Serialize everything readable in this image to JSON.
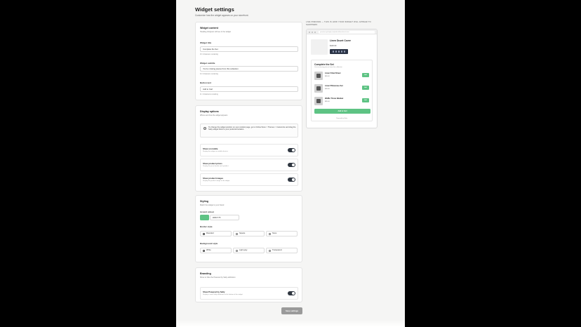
{
  "header": {
    "title": "Widget settings",
    "subtitle": "Customize how the widget appears on your storefront."
  },
  "content": {
    "title": "Widget content",
    "description": "Heading shoppers will see in the widget",
    "title_label": "Widget title",
    "title_value": "Complete the Set",
    "title_count": "16 / characters remaining",
    "subtitle_label": "Widget subtitle",
    "subtitle_value": "You're missing pieces from this collection",
    "subtitle_count": "44 / characters remaining",
    "button_label": "Button text",
    "button_value": "Add to Cart",
    "button_count": "11 / characters remaining"
  },
  "display": {
    "title": "Display options",
    "description": "Where and how the widget appears",
    "notice": "To change the widget position on your product page, go to Online Store > Themes > Customize and drag the Salty widget block to your preferred location.",
    "toggles": [
      {
        "title": "Show on mobile",
        "desc": "Display the widget on mobile devices"
      },
      {
        "title": "Show product prices",
        "desc": "Display the price beside each product"
      },
      {
        "title": "Show product images",
        "desc": "Display the product image in the widget"
      }
    ]
  },
  "styling": {
    "title": "Styling",
    "description": "Match the widget to your brand",
    "accent_label": "Accent colour",
    "accent_value": "#28C775",
    "accent_color": "#5ec384",
    "border_label": "Border style",
    "border_options": [
      "Rounded",
      "Square",
      "None"
    ],
    "background_label": "Background style",
    "background_options": [
      "White",
      "Light gray",
      "Transparent"
    ]
  },
  "branding": {
    "title": "Branding",
    "description": "Show or hide the Powered by Salty attribution",
    "toggle_title": "Show Powered by Salty",
    "toggle_desc": "Display a small Salty attribution at the bottom of the widget"
  },
  "save_label": "Save settings",
  "preview": {
    "label": "Live preview — this is how your widget will appear to shoppers",
    "url": "yourstore.myshopify.com/products/linen-duvet-cover",
    "product_name": "Linen Duvet Cover",
    "product_price": "$120.00",
    "widget_title": "Complete the Set",
    "widget_subtitle": "You're missing pieces from this collection",
    "items": [
      {
        "name": "Linen Fitted Sheet",
        "price": "$65.00",
        "add": "Add"
      },
      {
        "name": "Linen Pillowcase Set",
        "price": "$45.00",
        "add": "Add"
      },
      {
        "name": "Waffle Throw Blanket",
        "price": "$85.00",
        "add": "Add"
      }
    ],
    "cta": "Add to Cart",
    "powered": "Powered by Salty"
  }
}
